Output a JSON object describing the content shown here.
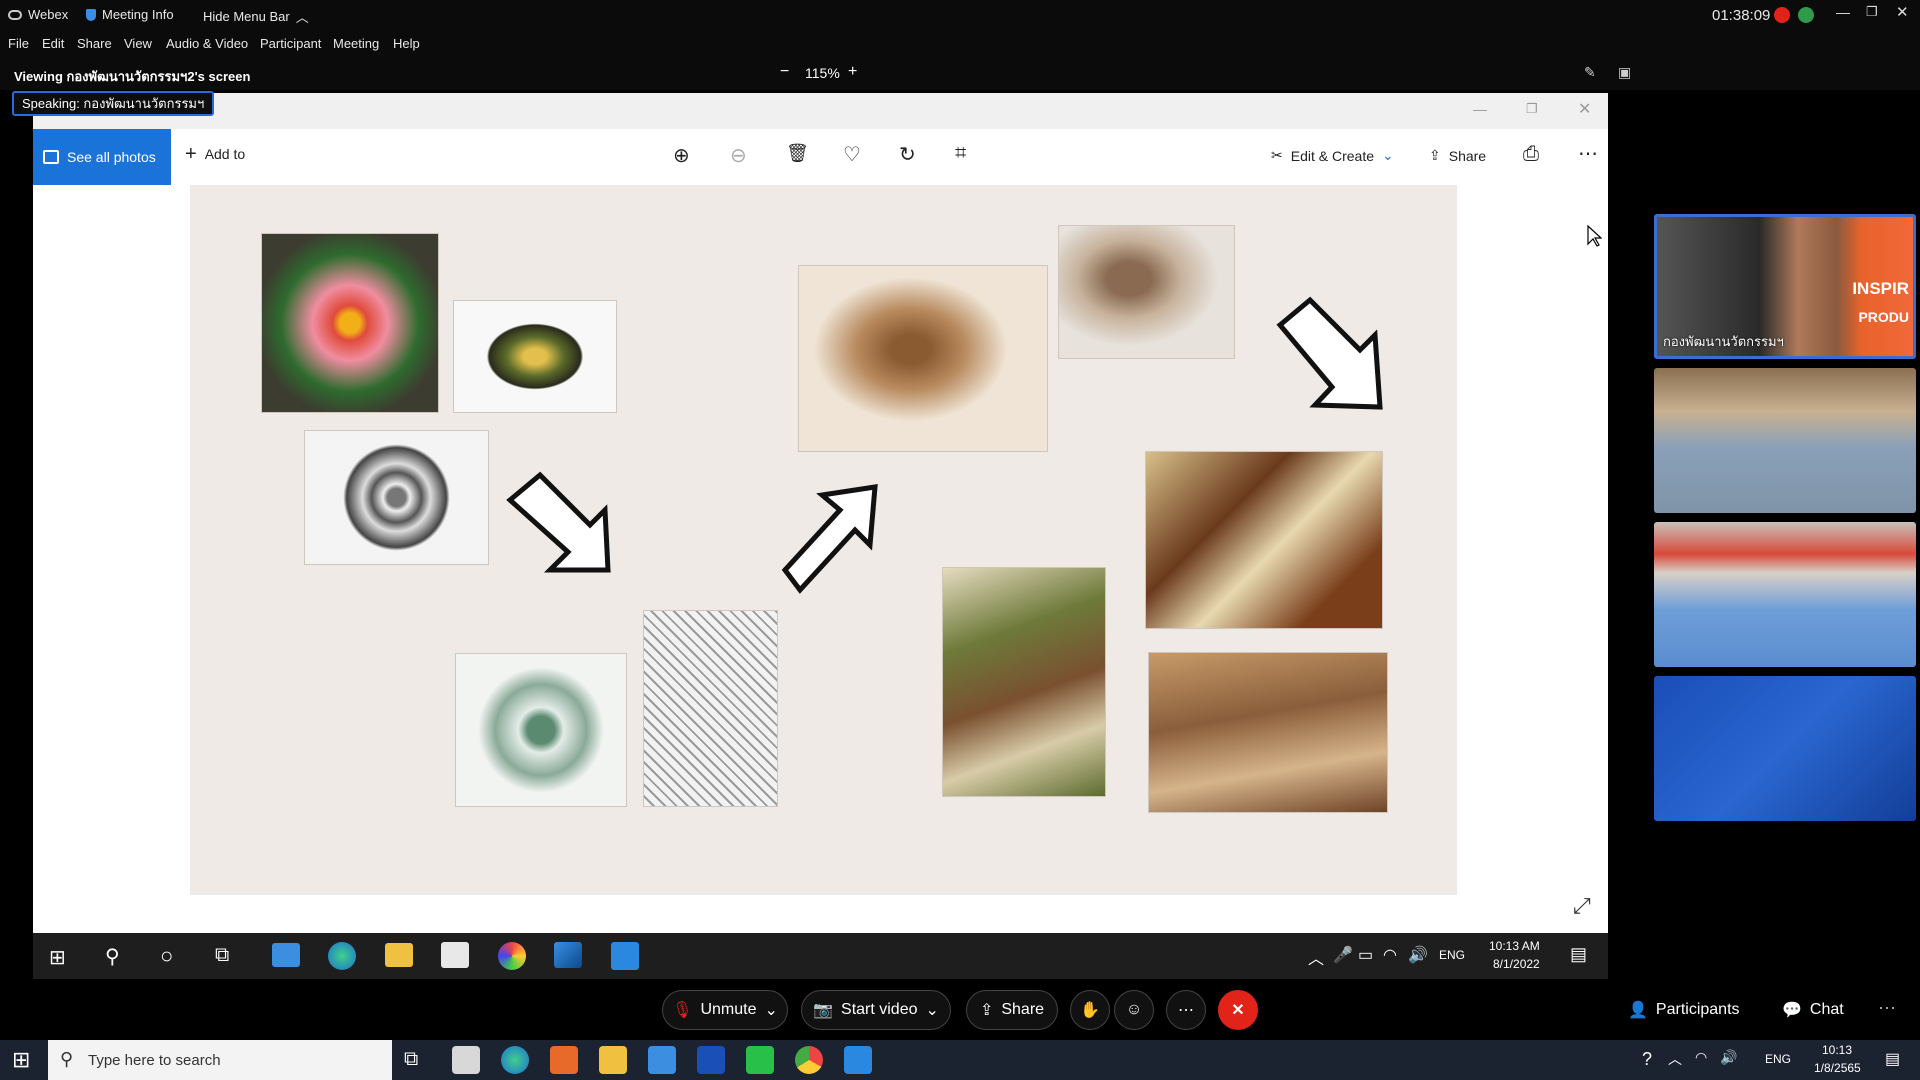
{
  "titlebar": {
    "app_name": "Webex",
    "meeting_info": "Meeting Info",
    "hide_menu": "Hide Menu Bar",
    "time": "01:38:09"
  },
  "menu": [
    "File",
    "Edit",
    "Share",
    "View",
    "Audio & Video",
    "Participant",
    "Meeting",
    "Help"
  ],
  "viewbar": {
    "viewing": "Viewing กองพัฒนานวัตกรรมฯ2's screen",
    "zoom": "115%"
  },
  "speaking": "Speaking: กองพัฒนานวัตกรรมฯ",
  "photos": {
    "see_all": "See all photos",
    "add_to": "Add to",
    "edit_create": "Edit & Create",
    "share": "Share",
    "tray_lang": "ENG",
    "tray_time": "10:13 AM",
    "tray_date": "8/1/2022"
  },
  "participants": {
    "tile1_name": "กองพัฒนานวัตกรรมฯ",
    "tile1_banner": "INSPIR",
    "tile1_banner2": "PRODU"
  },
  "controls": {
    "unmute": "Unmute",
    "start_video": "Start video",
    "share": "Share",
    "participants": "Participants",
    "chat": "Chat"
  },
  "taskbar": {
    "search_placeholder": "Type here to search",
    "lang": "ENG",
    "time": "10:13",
    "date": "1/8/2565"
  },
  "colors": {
    "accent_blue": "#1a73d9",
    "end_red": "#e2231a"
  }
}
